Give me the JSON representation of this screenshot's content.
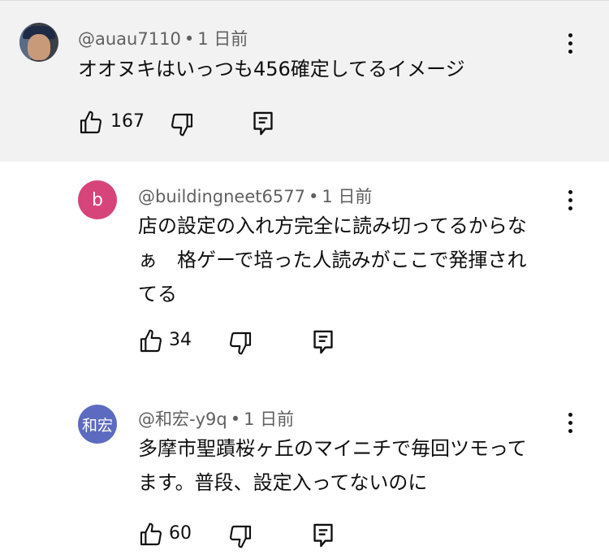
{
  "comments": [
    {
      "handle": "@auau7110",
      "time": "1 日前",
      "text": "オオヌキはいっつも456確定してるイメージ",
      "likes": "167",
      "avatar_icon": "user-photo-avatar"
    },
    {
      "handle": "@buildingneet6577",
      "time": "1 日前",
      "text": "店の設定の入れ方完全に読み切ってるからな\nぁ　格ゲーで培った人読みがここで発揮され\nてる",
      "likes": "34",
      "avatar_letter": "b",
      "avatar_color": "#d6447a"
    },
    {
      "handle": "@和宏-y9q",
      "time": "1 日前",
      "text": "多摩市聖蹟桜ヶ丘のマイニチで毎回ツモって\nます。普段、設定入ってないのに",
      "likes": "60",
      "avatar_letter": "和宏",
      "avatar_color": "#5c6bc0"
    }
  ],
  "separator": "•",
  "icons": [
    "thumbs-up-icon",
    "thumbs-down-icon",
    "reply-icon",
    "more-vert-icon"
  ]
}
